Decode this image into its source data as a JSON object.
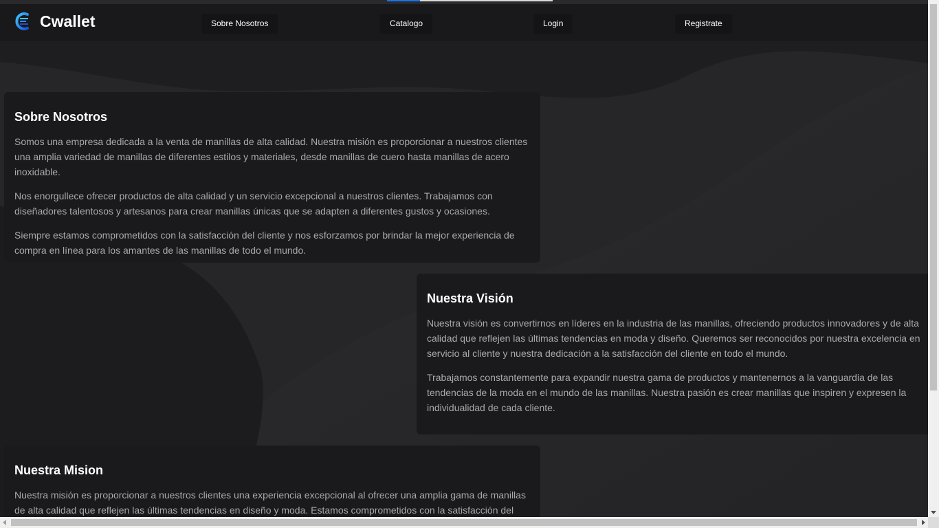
{
  "app": {
    "brand_name": "Cwallet",
    "logo_icon": "cwallet-logo-icon",
    "accent_color": "#1a73e8"
  },
  "nav": {
    "items": [
      {
        "label": "Sobre Nosotros"
      },
      {
        "label": "Catalogo"
      },
      {
        "label": "Login"
      },
      {
        "label": "Registrate"
      }
    ]
  },
  "sections": {
    "about": {
      "title": "Sobre Nosotros",
      "paragraphs": [
        "Somos una empresa dedicada a la venta de manillas de alta calidad. Nuestra misión es proporcionar a nuestros clientes una amplia variedad de manillas de diferentes estilos y materiales, desde manillas de cuero hasta manillas de acero inoxidable.",
        "Nos enorgullece ofrecer productos de alta calidad y un servicio excepcional a nuestros clientes. Trabajamos con diseñadores talentosos y artesanos para crear manillas únicas que se adapten a diferentes gustos y ocasiones.",
        "Siempre estamos comprometidos con la satisfacción del cliente y nos esforzamos por brindar la mejor experiencia de compra en línea para los amantes de las manillas de todo el mundo."
      ]
    },
    "vision": {
      "title": "Nuestra Visión",
      "paragraphs": [
        "Nuestra visión es convertirnos en líderes en la industria de las manillas, ofreciendo productos innovadores y de alta calidad que reflejen las últimas tendencias en moda y diseño. Queremos ser reconocidos por nuestra excelencia en servicio al cliente y nuestra dedicación a la satisfacción del cliente en todo el mundo.",
        "Trabajamos constantemente para expandir nuestra gama de productos y mantenernos a la vanguardia de las tendencias de la moda en el mundo de las manillas. Nuestra pasión es crear manillas que inspiren y expresen la individualidad de cada cliente."
      ]
    },
    "mission": {
      "title": "Nuestra Mision",
      "paragraphs": [
        "Nuestra misión es proporcionar a nuestros clientes una experiencia excepcional al ofrecer una amplia gama de manillas de alta calidad que reflejen las últimas tendencias en diseño y moda. Estamos comprometidos con la satisfacción del cliente y"
      ]
    }
  }
}
